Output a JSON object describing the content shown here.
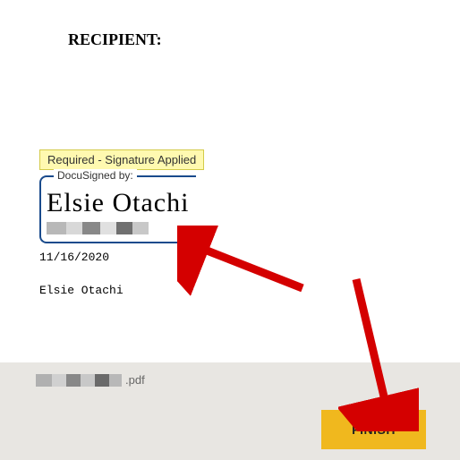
{
  "document": {
    "recipient_label": "RECIPIENT:",
    "status_chip": "Required - Signature Applied",
    "signature_frame_title": "DocuSigned by:",
    "signature_name": "Elsie Otachi",
    "date": "11/16/2020",
    "printed_name": "Elsie Otachi"
  },
  "footer": {
    "file_extension": ".pdf",
    "finish_label": "FINISH"
  }
}
